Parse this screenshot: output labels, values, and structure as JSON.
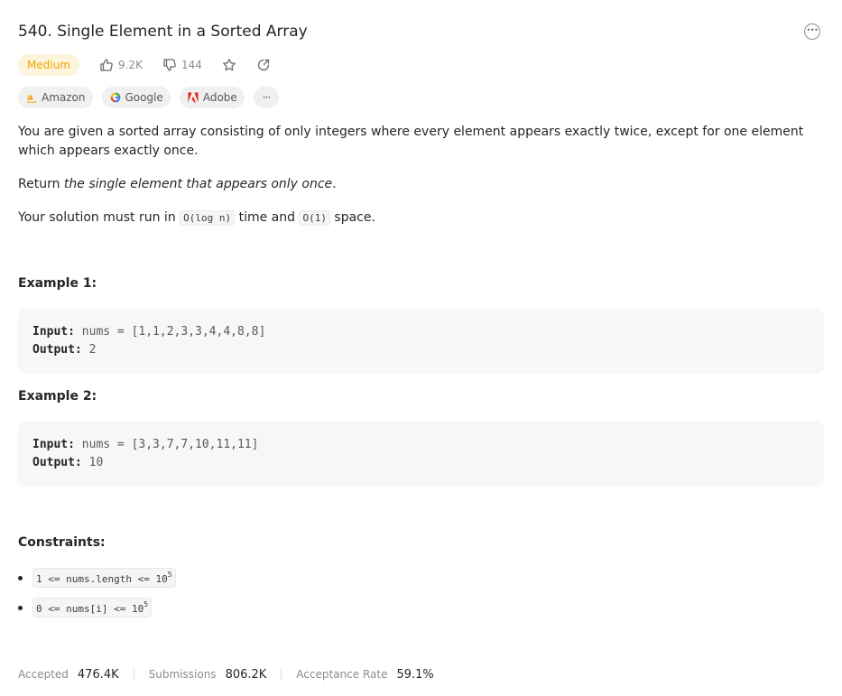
{
  "problem": {
    "title": "540. Single Element in a Sorted Array",
    "difficulty": "Medium",
    "likes": "9.2K",
    "dislikes": "144",
    "difficulty_color": "#f0a500"
  },
  "companies": {
    "tags": [
      {
        "label": "Amazon",
        "icon": "amazon-icon"
      },
      {
        "label": "Google",
        "icon": "google-icon"
      },
      {
        "label": "Adobe",
        "icon": "adobe-icon"
      }
    ],
    "more_label": "···"
  },
  "description": {
    "p1": "You are given a sorted array consisting of only integers where every element appears exactly twice, except for one element which appears exactly once.",
    "p2_prefix": "Return ",
    "p2_em": "the single element that appears only once",
    "p2_suffix": ".",
    "p3_prefix": "Your solution must run in ",
    "p3_code1": "O(log n)",
    "p3_mid": " time and ",
    "p3_code2": "O(1)",
    "p3_suffix": " space."
  },
  "examples": [
    {
      "heading": "Example 1:",
      "input_label": "Input:",
      "input_value": " nums = [1,1,2,3,3,4,4,8,8]",
      "output_label": "Output:",
      "output_value": " 2"
    },
    {
      "heading": "Example 2:",
      "input_label": "Input:",
      "input_value": " nums = [3,3,7,7,10,11,11]",
      "output_label": "Output:",
      "output_value": " 10"
    }
  ],
  "constraints": {
    "heading": "Constraints:",
    "items": [
      {
        "text": "1 <= nums.length <= 10",
        "sup": "5"
      },
      {
        "text": "0 <= nums[i] <= 10",
        "sup": "5"
      }
    ]
  },
  "stats": {
    "accepted_label": "Accepted",
    "accepted_value": "476.4K",
    "submissions_label": "Submissions",
    "submissions_value": "806.2K",
    "rate_label": "Acceptance Rate",
    "rate_value": "59.1%"
  }
}
